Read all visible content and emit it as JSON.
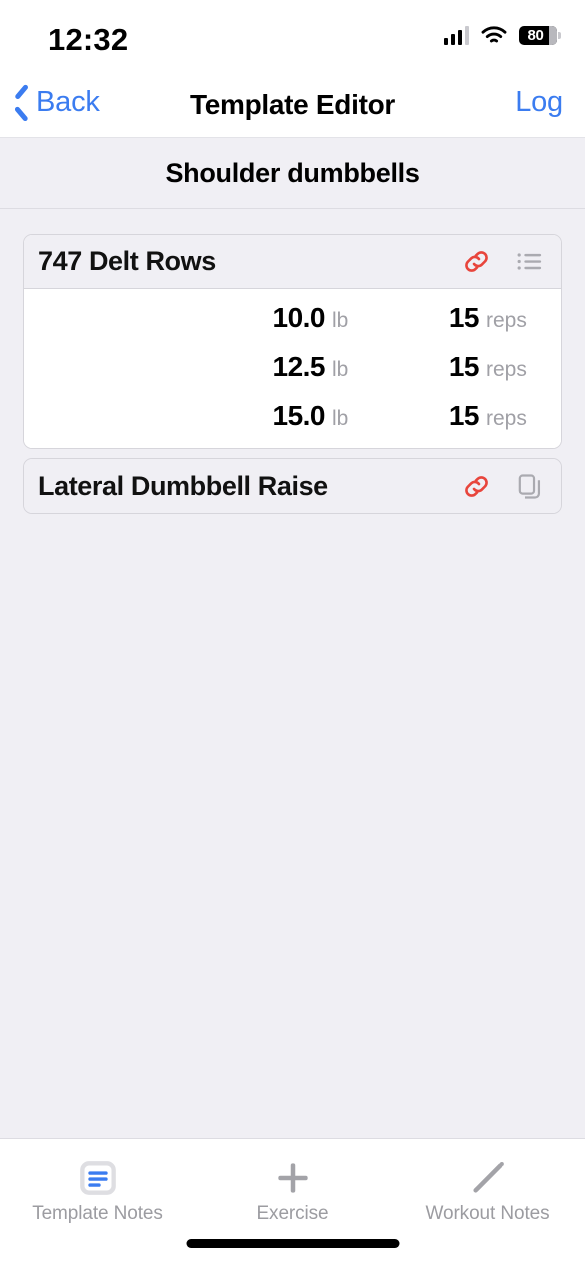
{
  "status_bar": {
    "time": "12:32",
    "battery_percent": "80",
    "signal_icon": "cellular-signal-icon",
    "wifi_icon": "wifi-icon",
    "battery_icon": "battery-icon"
  },
  "nav": {
    "back_label": "Back",
    "back_icon": "chevron-left-icon",
    "title": "Template Editor",
    "log_label": "Log"
  },
  "section": {
    "title": "Shoulder dumbbells"
  },
  "exercises": [
    {
      "name": "747 Delt Rows",
      "link_icon": "link-icon",
      "secondary_icon": "list-bullet-icon",
      "sets": [
        {
          "weight": "10.0",
          "weight_unit": "lb",
          "reps": "15",
          "reps_unit": "reps"
        },
        {
          "weight": "12.5",
          "weight_unit": "lb",
          "reps": "15",
          "reps_unit": "reps"
        },
        {
          "weight": "15.0",
          "weight_unit": "lb",
          "reps": "15",
          "reps_unit": "reps"
        }
      ]
    },
    {
      "name": "Lateral Dumbbell Raise",
      "link_icon": "link-icon",
      "secondary_icon": "copy-icon",
      "sets": []
    }
  ],
  "toolbar": [
    {
      "label": "Template Notes",
      "icon": "document-lines-icon"
    },
    {
      "label": "Exercise",
      "icon": "plus-icon"
    },
    {
      "label": "Workout Notes",
      "icon": "pencil-icon"
    }
  ],
  "colors": {
    "accent_blue": "#3B7CF0",
    "link_red": "#E8453C",
    "icon_gray": "#AAAAB0",
    "page_bg": "#F0EFF4",
    "card_bg": "#FFFFFF",
    "card_header_bg": "#F0EFF4",
    "muted_text": "#9C9CA1"
  }
}
